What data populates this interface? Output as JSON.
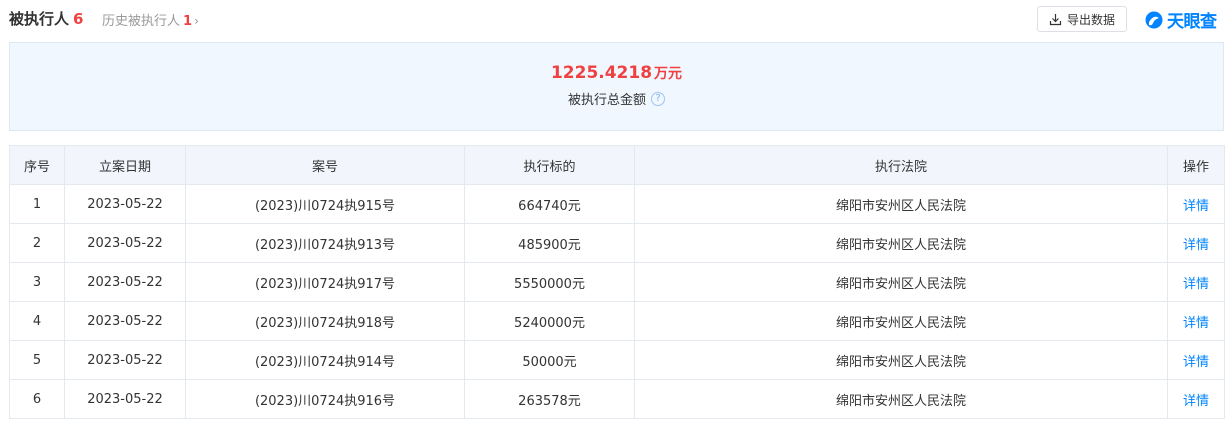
{
  "tabs": {
    "active": {
      "label": "被执行人",
      "count": "6"
    },
    "history": {
      "label": "历史被执行人",
      "count": "1",
      "chevron": "›"
    }
  },
  "export_button": {
    "label": "导出数据",
    "icon": "download-icon"
  },
  "logo": {
    "text": "天眼查",
    "color": "#0084ff"
  },
  "summary": {
    "amount": "1225.4218",
    "unit": "万元",
    "label": "被执行总金额",
    "help": "?"
  },
  "table": {
    "headers": [
      "序号",
      "立案日期",
      "案号",
      "执行标的",
      "执行法院",
      "操作"
    ],
    "rows": [
      {
        "index": "1",
        "date": "2023-05-22",
        "case_no": "(2023)川0724执915号",
        "amount": "664740元",
        "court": "绵阳市安州区人民法院",
        "action": "详情"
      },
      {
        "index": "2",
        "date": "2023-05-22",
        "case_no": "(2023)川0724执913号",
        "amount": "485900元",
        "court": "绵阳市安州区人民法院",
        "action": "详情"
      },
      {
        "index": "3",
        "date": "2023-05-22",
        "case_no": "(2023)川0724执917号",
        "amount": "5550000元",
        "court": "绵阳市安州区人民法院",
        "action": "详情"
      },
      {
        "index": "4",
        "date": "2023-05-22",
        "case_no": "(2023)川0724执918号",
        "amount": "5240000元",
        "court": "绵阳市安州区人民法院",
        "action": "详情"
      },
      {
        "index": "5",
        "date": "2023-05-22",
        "case_no": "(2023)川0724执914号",
        "amount": "50000元",
        "court": "绵阳市安州区人民法院",
        "action": "详情"
      },
      {
        "index": "6",
        "date": "2023-05-22",
        "case_no": "(2023)川0724执916号",
        "amount": "263578元",
        "court": "绵阳市安州区人民法院",
        "action": "详情"
      }
    ]
  },
  "colors": {
    "accent_red": "#f04142",
    "link_blue": "#0084ff",
    "summary_bg": "#f0f7ff",
    "header_bg": "#f2f6fc"
  }
}
